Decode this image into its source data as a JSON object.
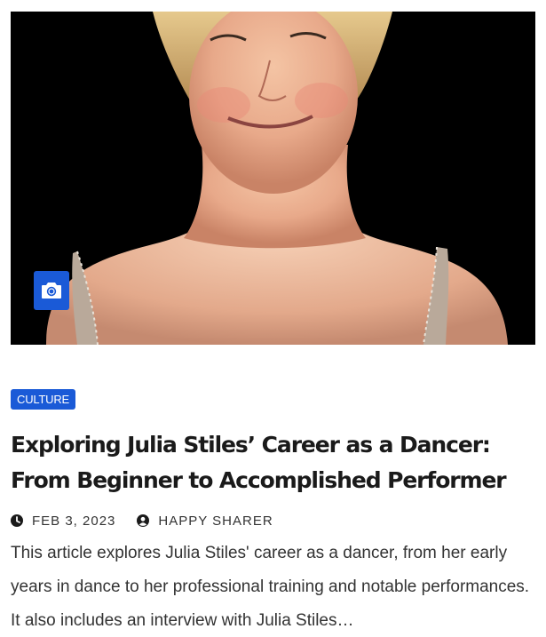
{
  "article": {
    "image_alt": "Julia Stiles",
    "media_icon": "camera-icon",
    "category": "CULTURE",
    "title": "Exploring Julia Stiles’ Career as a Dancer: From Beginner to Accomplished Performer",
    "date": "FEB 3, 2023",
    "date_icon": "clock-icon",
    "author": "HAPPY SHARER",
    "author_icon": "user-circle-icon",
    "excerpt": "This article explores Julia Stiles' career as a dancer, from her early years in dance to her professional training and notable performances. It also includes an interview with Julia Stiles…"
  },
  "colors": {
    "accent": "#1a5ad7",
    "text": "#1a1a1a",
    "meta_text": "#333333",
    "image_background": "#000000"
  }
}
